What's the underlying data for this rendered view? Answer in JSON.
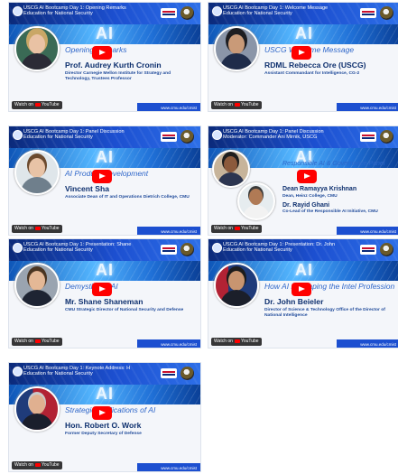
{
  "watch_on_label": "Watch on",
  "youtube_label": "YouTube",
  "ai_label": "AI",
  "url": "www.cmu.edu/cmist",
  "colors": {
    "accent": "#1c4fd0",
    "play_button": "#ff0000",
    "speaker_text": "#0d2f6e"
  },
  "videos": [
    {
      "title": "USCG AI Bootcamp Day 1: Opening Remarks",
      "subtitle": "Education for National Security",
      "session": "Opening Remarks",
      "speaker": "Prof. Audrey Kurth Cronin",
      "role": "Director Carnegie Mellon Institute for Strategy and Technology, Trustees Professor",
      "speaker2": "",
      "role2": ""
    },
    {
      "title": "USCG AI Bootcamp Day 1: Welcome Message",
      "subtitle": "Education for National Security",
      "session": "USCG Welcome Message",
      "speaker": "RDML Rebecca Ore (USCG)",
      "role": "Assistant Commandant for Intelligence, CG-2",
      "speaker2": "",
      "role2": ""
    },
    {
      "title": "USCG AI Bootcamp Day 1: Panel Discussion",
      "subtitle": "Education for National Security",
      "session": "AI Product Development",
      "speaker": "Vincent Sha",
      "role": "Associate Dean of IT and Operations Dietrich College, CMU",
      "speaker2": "",
      "role2": ""
    },
    {
      "title": "USCG AI Bootcamp Day 1: Panel Discussion",
      "subtitle": "Moderator: Commander Ani Mirnik, USCG",
      "session": "Responsible AI & Governance Panel",
      "speaker": "Dean Ramayya Krishnan",
      "role": "Dean, Heinz College, CMU",
      "speaker2": "Dr. Rayid Ghani",
      "role2": "Co-Lead of the Responsible AI Initiative, CMU"
    },
    {
      "title": "USCG AI Bootcamp Day 1: Presentation: Shane",
      "subtitle": "Education for National Security",
      "session": "Demystifying AI",
      "speaker": "Mr. Shane Shaneman",
      "role": "CMU Strategic Director of National Security and Defense",
      "speaker2": "",
      "role2": ""
    },
    {
      "title": "USCG AI Bootcamp Day 1: Presentation: Dr. John",
      "subtitle": "Education for National Security",
      "session": "How AI is Shaping the Intel Profession",
      "speaker": "Dr. John Beieler",
      "role": "Director of Science & Technology Office of the Director of National Intelligence",
      "speaker2": "",
      "role2": ""
    },
    {
      "title": "USCG AI Bootcamp Day 1: Keynote Address: H",
      "subtitle": "Education for National Security",
      "session": "Strategic Implications of AI",
      "speaker": "Hon. Robert O. Work",
      "role": "Former Deputy Secretary of Defense",
      "speaker2": "",
      "role2": ""
    }
  ]
}
